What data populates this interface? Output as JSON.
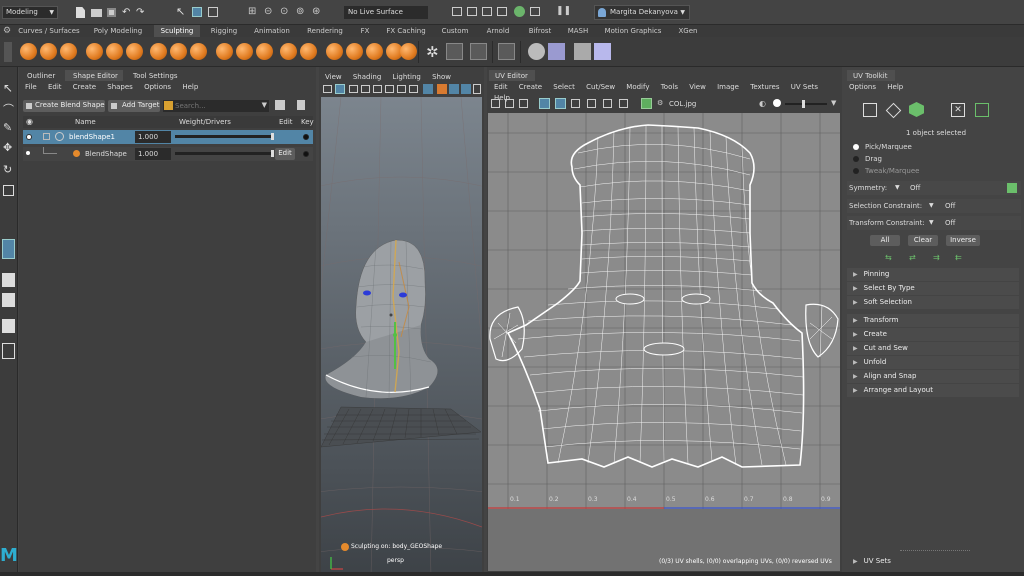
{
  "statusline": {
    "mode": "Modeling",
    "live_surface": "No Live Surface",
    "user": "Margita Dekanyova"
  },
  "shelf_tabs": [
    "Curves / Surfaces",
    "Poly Modeling",
    "Sculpting",
    "Rigging",
    "Animation",
    "Rendering",
    "FX",
    "FX Caching",
    "Custom",
    "Arnold",
    "Bifrost",
    "MASH",
    "Motion Graphics",
    "XGen"
  ],
  "left_panel": {
    "tabs": [
      "Outliner",
      "Shape Editor",
      "Tool Settings"
    ],
    "menu": [
      "File",
      "Edit",
      "Create",
      "Shapes",
      "Options",
      "Help"
    ],
    "create_blend_shape": "Create Blend Shape",
    "add_target": "Add Target",
    "search_placeholder": "Search...",
    "columns": {
      "name": "Name",
      "weight": "Weight/Drivers",
      "edit": "Edit",
      "key": "Key"
    },
    "rows": [
      {
        "name": "blendShape1",
        "value": "1.000",
        "edit": ""
      },
      {
        "name": "BlendShape",
        "value": "1.000",
        "edit": "Edit"
      }
    ]
  },
  "viewport": {
    "menu": [
      "View",
      "Shading",
      "Lighting",
      "Show"
    ],
    "hud_status": "Sculpting on: body_GEOShape",
    "camera": "persp"
  },
  "uv_editor": {
    "title": "UV Editor",
    "menu": [
      "Edit",
      "Create",
      "Select",
      "Cut/Sew",
      "Modify",
      "Tools",
      "View",
      "Image",
      "Textures",
      "UV Sets",
      "Help"
    ],
    "texture": "COL.jpg",
    "axis_ticks": [
      "0.1",
      "0.2",
      "0.3",
      "0.4",
      "0.5",
      "0.6",
      "0.7",
      "0.8",
      "0.9"
    ],
    "status": "(0/3) UV shells, (0/0) overlapping UVs, (0/0) reversed UVs"
  },
  "uv_toolkit": {
    "title": "UV Toolkit",
    "menu": [
      "Options",
      "Help"
    ],
    "selected": "1 object selected",
    "modes": [
      "Pick/Marquee",
      "Drag",
      "Tweak/Marquee"
    ],
    "symmetry_label": "Symmetry:",
    "symmetry_value": "Off",
    "sel_constraint_label": "Selection Constraint:",
    "sel_constraint_value": "Off",
    "xf_constraint_label": "Transform Constraint:",
    "xf_constraint_value": "Off",
    "buttons": [
      "All",
      "Clear",
      "Inverse"
    ],
    "sections_top": [
      "Pinning",
      "Select By Type",
      "Soft Selection"
    ],
    "sections": [
      "Transform",
      "Create",
      "Cut and Sew",
      "Unfold",
      "Align and Snap",
      "Arrange and Layout"
    ],
    "uv_sets": "UV Sets"
  },
  "colors": {
    "accent": "#5285a6",
    "orange": "#e58a2c",
    "blue_highlight": "#2f69a1"
  }
}
